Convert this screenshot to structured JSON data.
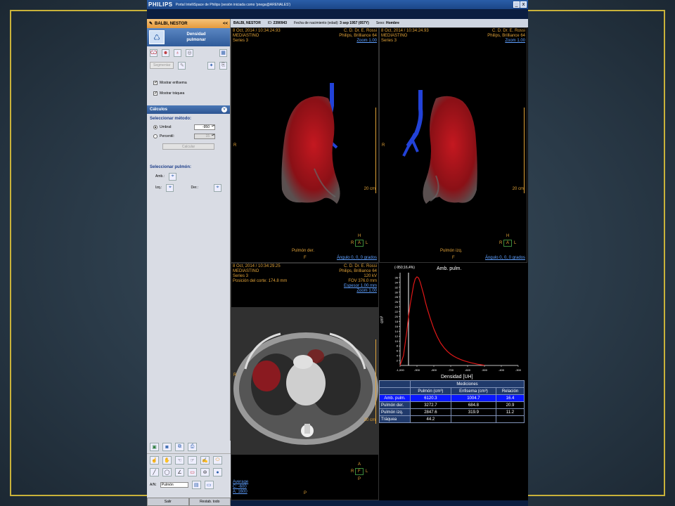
{
  "app": {
    "brand": "PHILIPS",
    "window_title": "Portal IntelliSpace de Philips (sesión iniciada como 'pnega@ARENALES')",
    "min": "_",
    "close": "x"
  },
  "patient": {
    "name": "BALBI, NESTOR",
    "collapse": "<<",
    "id_label": "ID:",
    "id": "2390943",
    "birth_label": "Fecha de nacimiento (edad):",
    "birth": "3 sep 1957 (057Y)",
    "sex_label": "Sexo:",
    "sex": "Hombre"
  },
  "tool": {
    "title_line1": "Densidad",
    "title_line2": "pulmonar",
    "disabled_button": "Segmentar",
    "show_emphysema": "Mostrar enfisema",
    "show_trachea": "Mostrar tráquea"
  },
  "calc": {
    "header": "Cálculos",
    "select_method": "Seleccionar método:",
    "threshold_label": "Umbral:",
    "threshold_value": "-950",
    "percentile_label": "Percentil:",
    "percentile_value": "15",
    "calc_button": "Calcular",
    "select_lung": "Seleccionar pulmón:",
    "both_label": "Amb.:",
    "left_label": "Izq.:",
    "right_label": "Der.:"
  },
  "bottom": {
    "an_label": "A/N:",
    "an_value": "Pulmón",
    "exit": "Salir",
    "reset": "Restab. todo"
  },
  "viewports": {
    "top_left": {
      "datetime": "8 Oct, 2014 / 10:34:24.93",
      "region": "MEDIASTINO",
      "series": "Series 3",
      "doctor": "C. D. Dr. E. Rossi",
      "scanner": "Philips, Brilliance 64",
      "zoom": "Zoom 1.00",
      "side": "R",
      "scale": "20 cm",
      "cube_top": "H",
      "cube_left": "R",
      "cube_center": "A",
      "cube_right": "L",
      "cube_bottom": "F",
      "lung_label": "Pulmón der.",
      "angle": "Ángulo 0, 0, 0 grados"
    },
    "top_right": {
      "datetime": "8 Oct, 2014 / 10:34:24.93",
      "region": "MEDIASTINO",
      "series": "Series 3",
      "doctor": "C. D. Dr. E. Rossi",
      "scanner": "Philips, Brilliance 64",
      "zoom": "Zoom 1.00",
      "side": "R",
      "scale": "20 cm",
      "cube_top": "H",
      "cube_left": "R",
      "cube_center": "A",
      "cube_right": "L",
      "cube_bottom": "F",
      "lung_label": "Pulmón izq.",
      "angle": "Ángulo 0, 0, 0 grados"
    },
    "bottom_left": {
      "datetime": "8 Oct, 2014 / 10:34:29.25",
      "region": "MEDIASTINO",
      "series": "Series 3",
      "slice_pos": "Posición del corte: 174.8 mm",
      "doctor": "C. D. Dr. E. Rossi",
      "scanner": "Philips, Brilliance 64",
      "kv": "120 kV",
      "fov": "FOV 376.0 mm",
      "thickness": "Espesor 1.00 mm",
      "zoom": "Zoom 1.00",
      "side": "R",
      "scale": "20 cm",
      "cube_top": "A",
      "cube_left": "R",
      "cube_center": "F",
      "cube_right": "L",
      "cube_bottom": "P",
      "bottom_p": "P",
      "avg": "Average",
      "wc": "C: -600",
      "ww": "A: 1600"
    }
  },
  "chart_data": {
    "type": "line",
    "title": "Amb. pulm.",
    "marker_label": "(-950;16,4%)",
    "xlabel": "Densidad [UH]",
    "ylabel": "cm³",
    "xlim": [
      -1000,
      -300
    ],
    "ylim": [
      0,
      38
    ],
    "x_ticks": [
      "-1,000",
      "-900",
      "-800",
      "-700",
      "-600",
      "-500",
      "-400",
      "-300"
    ],
    "y_ticks": [
      "2",
      "4",
      "6",
      "8",
      "10",
      "12",
      "14",
      "16",
      "18",
      "20",
      "22",
      "24",
      "26",
      "28",
      "30",
      "32",
      "34",
      "36"
    ],
    "threshold_x": -950,
    "series": [
      {
        "x": [
          -1000,
          -980,
          -960,
          -950,
          -940,
          -930,
          -920,
          -910,
          -900,
          -890,
          -880,
          -870,
          -860,
          -850,
          -840,
          -820,
          -800,
          -780,
          -760,
          -740,
          -720,
          -700,
          -680,
          -660,
          -640,
          -620,
          -600,
          -580,
          -560,
          -540,
          -520,
          -500
        ],
        "y": [
          0,
          4,
          14,
          20,
          25,
          29,
          33,
          35.5,
          36.3,
          35.8,
          34,
          31.5,
          29,
          26,
          23.5,
          19,
          15,
          11.8,
          9.2,
          7.3,
          5.8,
          4.6,
          3.7,
          3,
          2.4,
          1.9,
          1.5,
          1.1,
          0.8,
          0.5,
          0.3,
          0.1
        ]
      }
    ]
  },
  "measurements": {
    "header": "Mediciones",
    "columns": [
      "Pulmón (cm³)",
      "Enfisema (cm³)",
      "Relación"
    ],
    "rows": [
      {
        "name": "Amb. pulm.",
        "lung": "6120.3",
        "emph": "1004.7",
        "ratio": "16.4"
      },
      {
        "name": "Pulmón der.",
        "lung": "3272.7",
        "emph": "684.8",
        "ratio": "20.9"
      },
      {
        "name": "Pulmón izq.",
        "lung": "2847.6",
        "emph": "319.9",
        "ratio": "11.2"
      },
      {
        "name": "Tráquea",
        "lung": "44.2",
        "emph": "",
        "ratio": ""
      }
    ]
  }
}
